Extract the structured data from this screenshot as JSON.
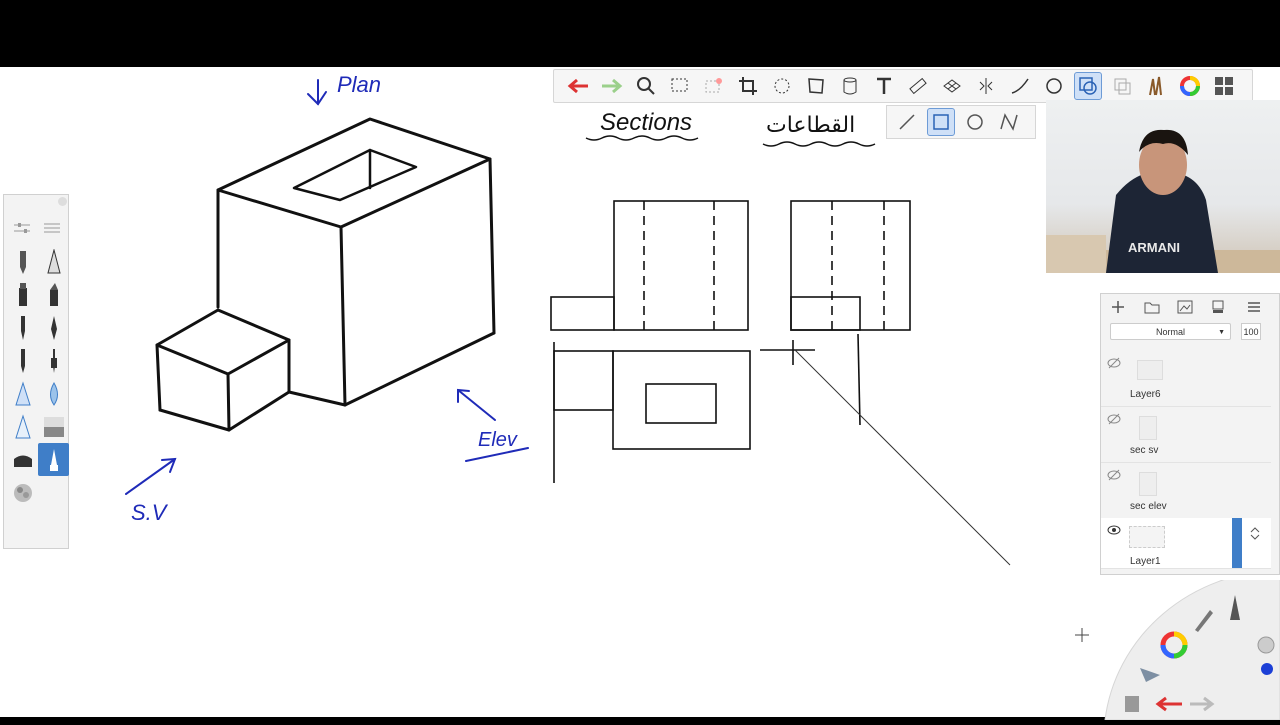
{
  "canvas": {
    "labels": {
      "plan": "Plan",
      "sections": "Sections",
      "arabic": "القطاعات",
      "elev": "Elev",
      "side": "S.V"
    }
  },
  "toolbar": {
    "tools": [
      "undo-icon",
      "redo-icon",
      "zoom-icon",
      "select-icon",
      "select-clear-icon",
      "crop-icon",
      "lasso-icon",
      "perspective-icon",
      "cylinder-icon",
      "text-icon",
      "ruler-icon",
      "grid-icon",
      "symmetry-icon",
      "curve-icon",
      "ellipse-icon",
      "shape-icon",
      "copy-icon",
      "brushes-icon",
      "color-wheel-icon",
      "menu-grid-icon"
    ],
    "active": "shape-icon",
    "shape_tools": [
      "line-icon",
      "rectangle-icon",
      "circle-icon",
      "polyline-icon"
    ]
  },
  "layers": {
    "blend_mode": "Normal",
    "opacity": "100",
    "items": [
      {
        "name": "Layer6",
        "visible": false
      },
      {
        "name": "sec sv",
        "visible": false
      },
      {
        "name": "sec elev",
        "visible": false
      },
      {
        "name": "Layer1",
        "visible": true,
        "selected": true
      }
    ]
  },
  "colors": {
    "ink_blue": "#1f2bb8",
    "ink_black": "#111111",
    "accent": "#3f7ec8"
  }
}
